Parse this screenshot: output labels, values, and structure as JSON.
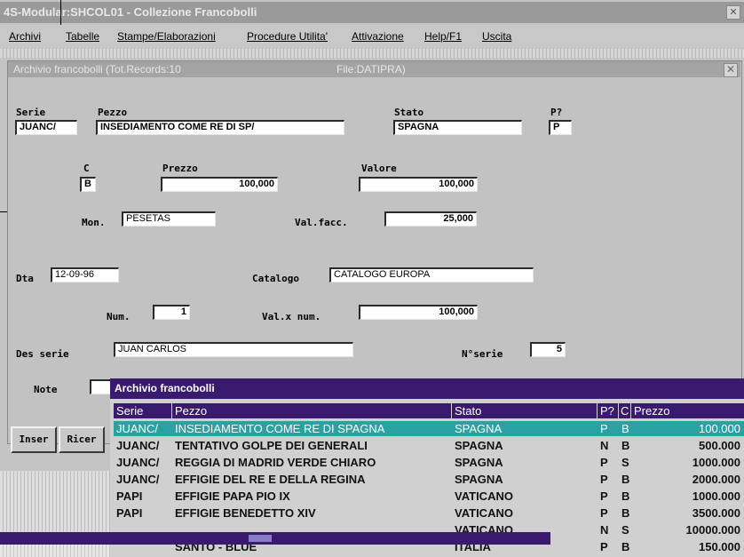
{
  "app": {
    "title": "4S-Modular:SHCOL01 - Collezione Francobolli",
    "close_glyph": "✕"
  },
  "menu": [
    "Archivi",
    "Tabelle",
    "Stampe/Elaborazioni",
    "Procedure Utilita'",
    "Attivazione",
    "Help/F1",
    "Uscita"
  ],
  "inner_window": {
    "title": "Archivio francobolli (Tot.Records:10",
    "file": "File:DATIPRA)"
  },
  "form": {
    "serie_label": "Serie",
    "serie_value": "JUANC/",
    "pezzo_label": "Pezzo",
    "pezzo_value": "INSEDIAMENTO COME RE DI SP/",
    "stato_label": "Stato",
    "stato_value": "SPAGNA",
    "p_label": "P?",
    "p_value": "P",
    "c_label": "C",
    "c_value": "B",
    "prezzo_label": "Prezzo",
    "prezzo_value": "100,000",
    "valore_label": "Valore",
    "valore_value": "100,000",
    "mon_label": "Mon.",
    "mon_value": "PESETAS",
    "valfacc_label": "Val.facc.",
    "valfacc_value": "25,000",
    "dta_label": "Dta",
    "dta_value": "12-09-96",
    "catalogo_label": "Catalogo",
    "catalogo_value": "CATALOGO EUROPA",
    "num_label": "Num.",
    "num_value": "1",
    "valxnum_label": "Val.x num.",
    "valxnum_value": "100,000",
    "desserie_label": "Des serie",
    "desserie_value": "JUAN CARLOS",
    "nserie_label": "N°serie",
    "nserie_value": "5",
    "note_label": "Note"
  },
  "buttons": {
    "inser": "Inser",
    "ricer": "Ricer"
  },
  "popup": {
    "title": "Archivio francobolli",
    "columns": [
      "Serie",
      "Pezzo",
      "Stato",
      "P?",
      "C",
      "Prezzo"
    ],
    "rows": [
      [
        "JUANC/",
        "INSEDIAMENTO COME RE DI SPAGNA",
        "SPAGNA",
        "P",
        "B",
        "100.000"
      ],
      [
        "JUANC/",
        "TENTATIVO GOLPE DEI GENERALI",
        "SPAGNA",
        "N",
        "B",
        "500.000"
      ],
      [
        "JUANC/",
        "REGGIA DI MADRID VERDE CHIARO",
        "SPAGNA",
        "P",
        "S",
        "1000.000"
      ],
      [
        "JUANC/",
        "EFFIGIE DEL RE E DELLA REGINA",
        "SPAGNA",
        "P",
        "B",
        "2000.000"
      ],
      [
        "PAPI",
        "EFFIGIE PAPA PIO IX",
        "VATICANO",
        "P",
        "B",
        "1000.000"
      ],
      [
        "PAPI",
        "EFFIGIE BENEDETTO XIV",
        "VATICANO",
        "P",
        "B",
        "3500.000"
      ],
      [
        "",
        "",
        "VATICANO",
        "N",
        "S",
        "10000.000"
      ],
      [
        "",
        "SANTO - BLUE",
        "ITALIA",
        "P",
        "B",
        "150.000"
      ]
    ],
    "selected_row": 0
  },
  "colors": {
    "accent": "#3a1a6e",
    "selection": "#2aa2a2"
  }
}
